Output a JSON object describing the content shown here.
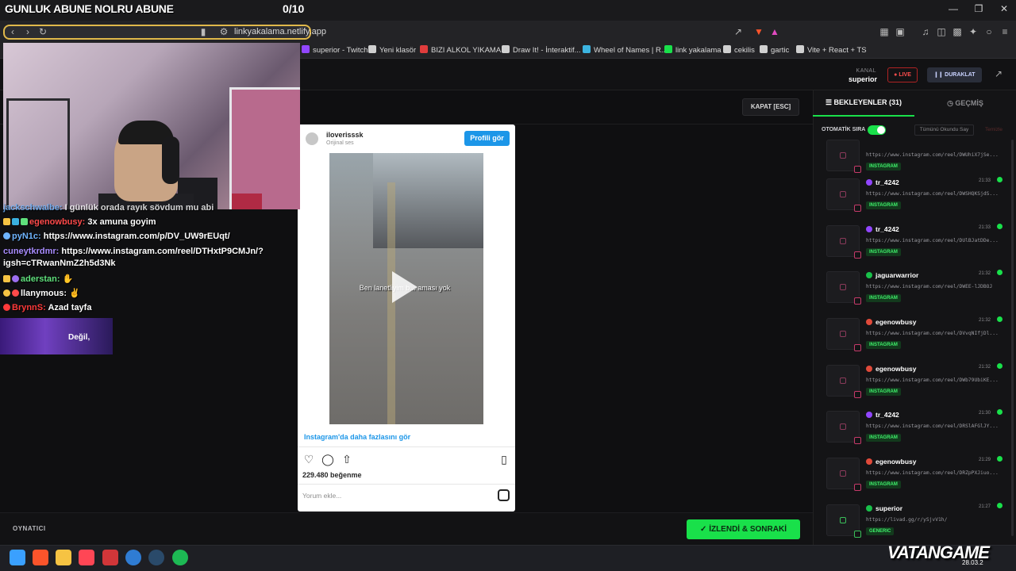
{
  "overlay": {
    "title": "GUNLUK ABUNE NOLRU ABUNE",
    "counter": "0/10"
  },
  "browser": {
    "url": "linkyakalama.netlify.app",
    "bookmarks": [
      {
        "label": "superior - Twitch",
        "color": "#9146ff"
      },
      {
        "label": "Yeni klasör",
        "color": "#d0d0d0"
      },
      {
        "label": "BIZI ALKOL YIKAMA...",
        "color": "#e03c3c"
      },
      {
        "label": "Draw It! - İnteraktif...",
        "color": "#d0d0d0"
      },
      {
        "label": "Wheel of Names | R...",
        "color": "#3cb4e0"
      },
      {
        "label": "link yakalama",
        "color": "#19e04a"
      },
      {
        "label": "cekilis",
        "color": "#d0d0d0"
      },
      {
        "label": "gartic",
        "color": "#d0d0d0"
      },
      {
        "label": "Vite + React + TS",
        "color": "#d0d0d0"
      }
    ]
  },
  "header": {
    "kanal_label": "KANAL",
    "kanal_name": "superior",
    "live_label": "LIVE",
    "pause_label": "DURAKLAT"
  },
  "stage": {
    "close_label": "KAPAT [ESC]",
    "player_label": "OYNATICI",
    "next_label": "İZLENDİ & SONRAKİ"
  },
  "chat": {
    "lines": [
      {
        "user": "jackschwalbe:",
        "text": "I günlük orada rayık sövdum mu abi",
        "cls": "u2"
      },
      {
        "user": "egenowbusy:",
        "text": "3x amuna goyim",
        "cls": "u1"
      },
      {
        "user": "pyN1c:",
        "text": "https://www.instagram.com/p/DV_UW9rEUqt/",
        "cls": "u2"
      },
      {
        "user": "cuneytkrdmr:",
        "text": "https://www.instagram.com/reel/DTHxtP9CMJn/?",
        "cls": "u3"
      },
      {
        "user": "",
        "text": "igsh=cTRwanNmZ2h5d3Nk",
        "cls": "u3"
      },
      {
        "user": "aderstan:",
        "text": "",
        "cls": "u4"
      },
      {
        "user": "llanymous:",
        "text": "",
        "cls": "u4"
      },
      {
        "user": "BrynnS:",
        "text": "Azad tayfa",
        "cls": "u5"
      }
    ],
    "banner_text": "Değil,"
  },
  "instagram": {
    "username": "iloverisssk",
    "audio": "Orijinal ses",
    "profile_button": "Profili gör",
    "caption": "Ben lanetliyim b... aması yok",
    "more_link": "Instagram'da daha fazlasını gör",
    "likes": "229.480 beğenme",
    "comment_placeholder": "Yorum ekle..."
  },
  "sidebar": {
    "tab_waiting": "BEKLEYENLER (31)",
    "tab_history": "GEÇMİŞ",
    "auto_label": "OTOMATİK SIRA",
    "auto_on": true,
    "mark_all": "Tümünü Okundu Say",
    "clear_all": "Temizle",
    "queue": [
      {
        "user": "",
        "time": "",
        "url": "https://www.instagram.com/reel/DWUhiX7jSe...",
        "tag": "INSTAGRAM",
        "dot": "#c63a6a"
      },
      {
        "user": "tr_4242",
        "time": "21:33",
        "url": "https://www.instagram.com/reel/DWSHQKSjdS...",
        "tag": "INSTAGRAM",
        "dot": "#9146ff"
      },
      {
        "user": "tr_4242",
        "time": "21:33",
        "url": "https://www.instagram.com/reel/DUlBJatDDe...",
        "tag": "INSTAGRAM",
        "dot": "#9146ff"
      },
      {
        "user": "jaguarwarrior",
        "time": "21:32",
        "url": "https://www.instagram.com/reel/DWEE-lJDBOJ",
        "tag": "INSTAGRAM",
        "dot": "#19c04a"
      },
      {
        "user": "egenowbusy",
        "time": "21:32",
        "url": "https://www.instagram.com/reel/DVvqNIfjDl...",
        "tag": "INSTAGRAM",
        "dot": "#e04a3a"
      },
      {
        "user": "egenowbusy",
        "time": "21:32",
        "url": "https://www.instagram.com/reel/DWb79UbiKE...",
        "tag": "INSTAGRAM",
        "dot": "#e04a3a"
      },
      {
        "user": "tr_4242",
        "time": "21:30",
        "url": "https://www.instagram.com/reel/DRSlAFGlJY...",
        "tag": "INSTAGRAM",
        "dot": "#9146ff"
      },
      {
        "user": "egenowbusy",
        "time": "21:29",
        "url": "https://www.instagram.com/reel/DRZpPXJiuo...",
        "tag": "INSTAGRAM",
        "dot": "#e04a3a"
      },
      {
        "user": "superior",
        "time": "21:27",
        "url": "https://livad.gg/r/ySjvV1h/",
        "tag": "GENERIC",
        "dot": "#19c04a"
      }
    ]
  },
  "watermark": {
    "brand": "VATANGAME",
    "date": "28.03.2"
  },
  "taskbar_icons": [
    {
      "name": "windows-start-icon",
      "color": "#3aa0ff"
    },
    {
      "name": "brave-browser-icon",
      "color": "#fb542b"
    },
    {
      "name": "file-explorer-icon",
      "color": "#f6c343"
    },
    {
      "name": "valorant-icon",
      "color": "#ff4655"
    },
    {
      "name": "riot-client-icon",
      "color": "#d13639"
    },
    {
      "name": "edge-icon",
      "color": "#2f7cd3"
    },
    {
      "name": "steam-icon",
      "color": "#1b2838"
    },
    {
      "name": "spotify-icon",
      "color": "#1db954"
    }
  ]
}
